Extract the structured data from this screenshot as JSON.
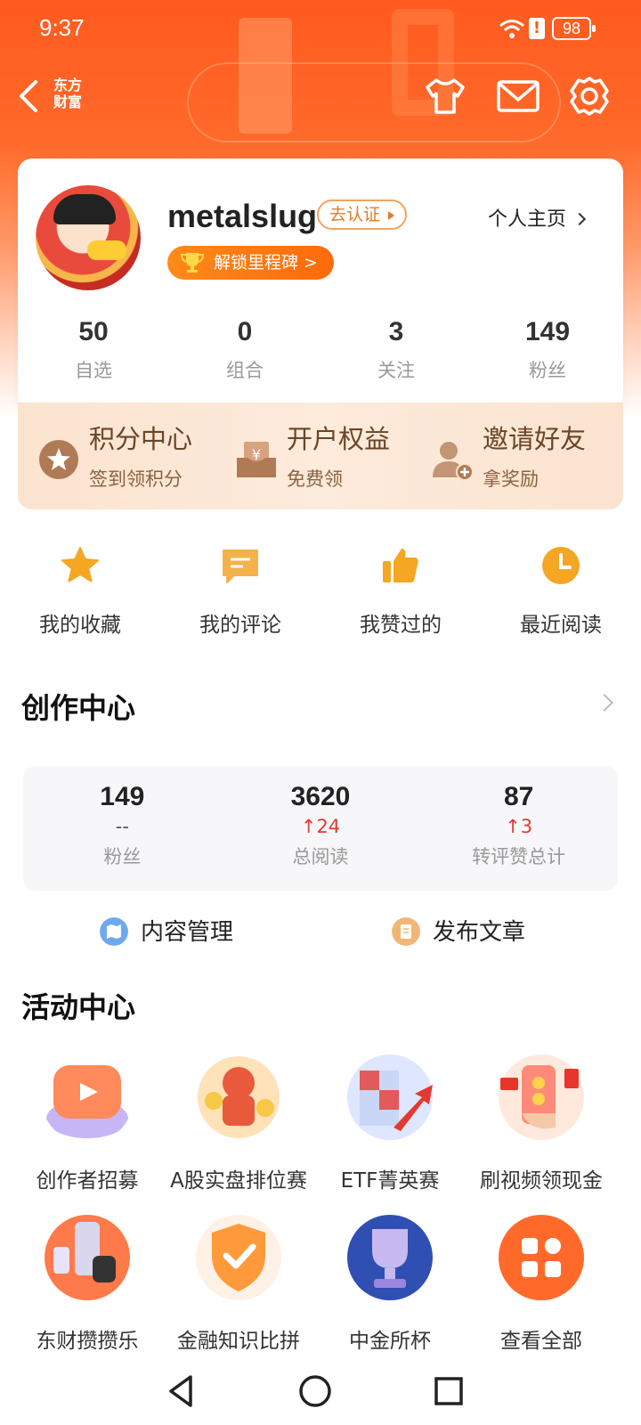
{
  "status_bar": {
    "time": "9:37",
    "battery": "98",
    "alert": "!"
  },
  "nav": {
    "brand": "东方财富",
    "brand_line1": "东方",
    "brand_line2": "财富"
  },
  "profile": {
    "username": "metalslug",
    "verify_label": "去认证",
    "milestone_label": "解锁里程碑 >",
    "homepage_label": "个人主页",
    "stats": [
      {
        "value": "50",
        "label": "自选"
      },
      {
        "value": "0",
        "label": "组合"
      },
      {
        "value": "3",
        "label": "关注"
      },
      {
        "value": "149",
        "label": "粉丝"
      }
    ]
  },
  "benefits": [
    {
      "title": "积分中心",
      "subtitle": "签到领积分",
      "icon": "star-badge-icon"
    },
    {
      "title": "开户权益",
      "subtitle": "免费领",
      "icon": "yen-box-icon"
    },
    {
      "title": "邀请好友",
      "subtitle": "拿奖励",
      "icon": "user-add-icon"
    }
  ],
  "shortcuts": [
    {
      "label": "我的收藏",
      "icon": "star-icon"
    },
    {
      "label": "我的评论",
      "icon": "comment-icon"
    },
    {
      "label": "我赞过的",
      "icon": "thumbs-up-icon"
    },
    {
      "label": "最近阅读",
      "icon": "clock-icon"
    }
  ],
  "creator": {
    "title": "创作中心",
    "stats": [
      {
        "value": "149",
        "delta": "--",
        "label": "粉丝"
      },
      {
        "value": "3620",
        "delta": "↑24",
        "label": "总阅读"
      },
      {
        "value": "87",
        "delta": "↑3",
        "label": "转评赞总计"
      }
    ],
    "actions": [
      {
        "label": "内容管理",
        "color": "#6fa8f0"
      },
      {
        "label": "发布文章",
        "color": "#f0b774"
      }
    ]
  },
  "activity": {
    "title": "活动中心",
    "items": [
      {
        "label": "创作者招募"
      },
      {
        "label": "A股实盘排位赛"
      },
      {
        "label": "ETF菁英赛"
      },
      {
        "label": "刷视频领现金"
      },
      {
        "label": "东财攒攒乐"
      },
      {
        "label": "金融知识比拼"
      },
      {
        "label": "中金所杯"
      },
      {
        "label": "查看全部"
      }
    ]
  },
  "colors": {
    "accent": "#ff5a1f",
    "gold": "#ff8a1a",
    "brown": "#6b4524"
  }
}
